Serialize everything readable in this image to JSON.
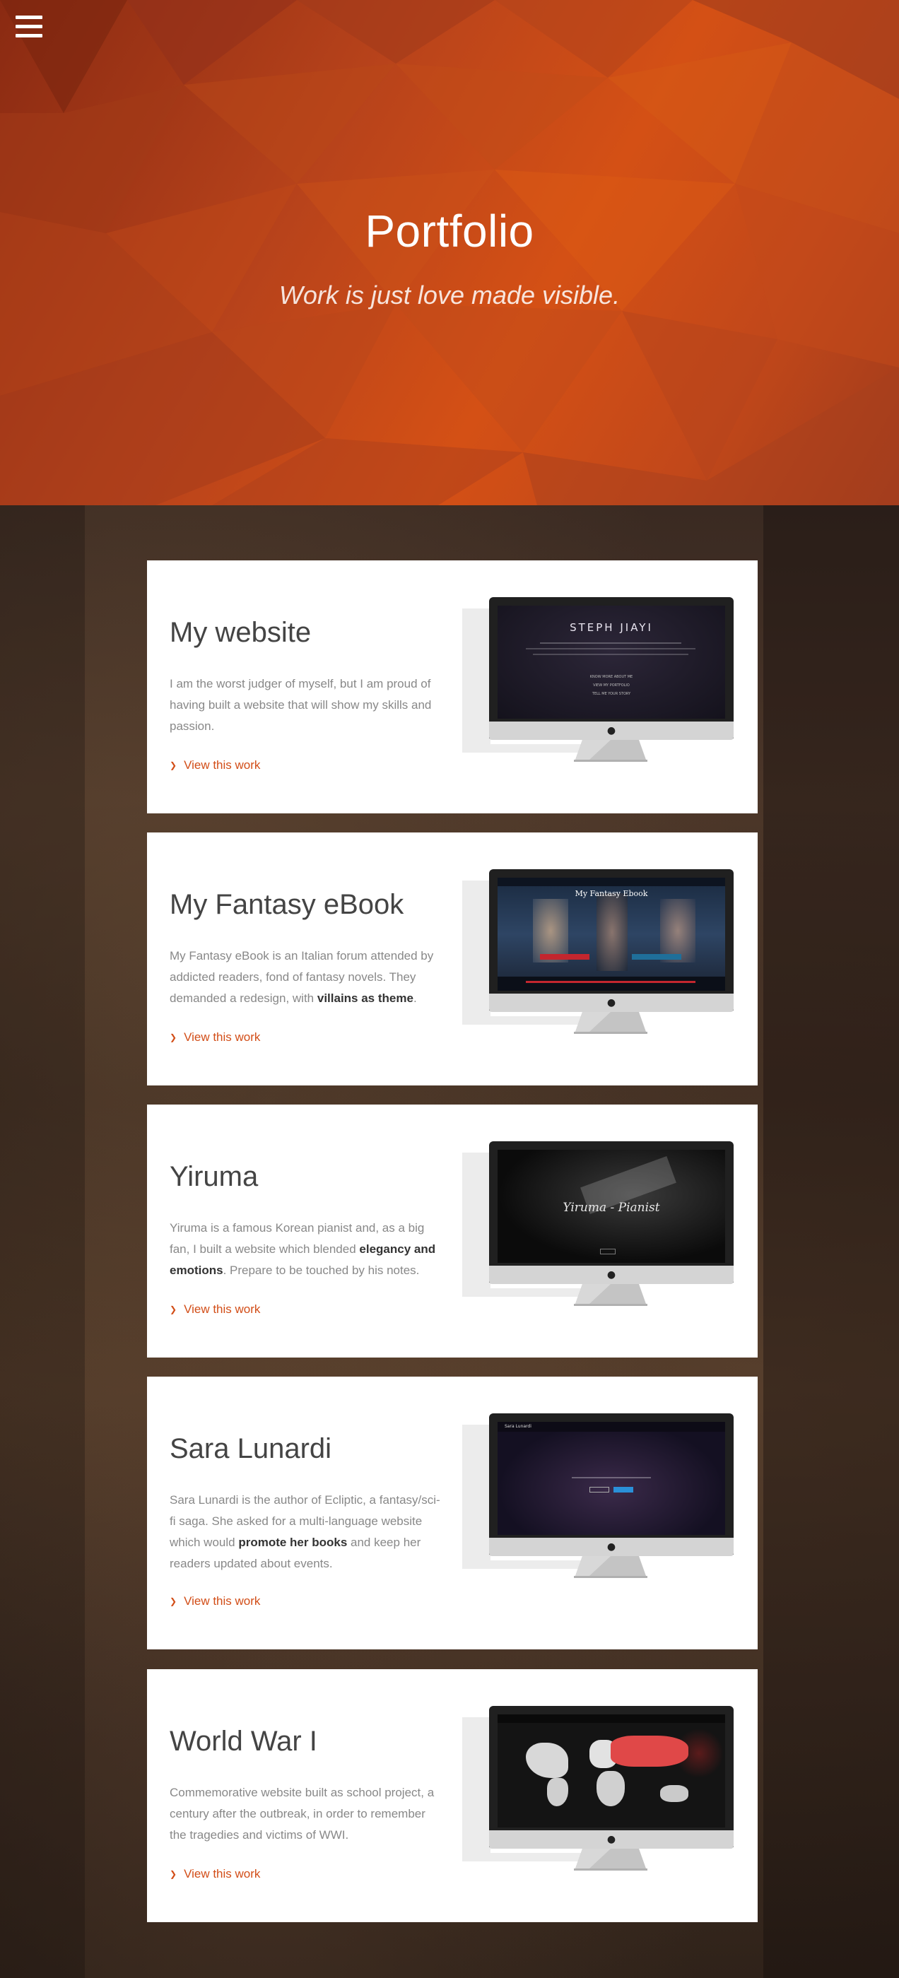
{
  "hero": {
    "title": "Portfolio",
    "subtitle": "Work is just love made visible.",
    "menu_icon": "hamburger-icon"
  },
  "colors": {
    "accent": "#d24d17",
    "hero_orange": "#c2481a",
    "title_text": "#444444",
    "body_text": "#888888"
  },
  "works": [
    {
      "title": "My website",
      "desc_html": "I am the worst judger of myself, but I am proud of having built a website that will show my skills and passion.",
      "link": "View this work",
      "screen": {
        "heading": "STEPH JIAYI",
        "items": [
          "KNOW MORE ABOUT ME",
          "VIEW MY PORTFOLIO",
          "TELL ME YOUR STORY"
        ]
      }
    },
    {
      "title": "My Fantasy eBook",
      "desc_before": "My Fantasy eBook is an Italian forum attended by addicted readers, fond of fantasy novels. They demanded a redesign, with ",
      "desc_bold": "villains as theme",
      "desc_after": ".",
      "link": "View this work",
      "screen": {
        "heading": "My Fantasy Ebook"
      }
    },
    {
      "title": "Yiruma",
      "desc_before": "Yiruma is a famous Korean pianist and, as a big fan, I built a website which blended ",
      "desc_bold": "elegancy and emotions",
      "desc_after": ". Prepare to be touched by his notes.",
      "link": "View this work",
      "screen": {
        "heading": "Yiruma - Pianist"
      }
    },
    {
      "title": "Sara Lunardi",
      "desc_before": "Sara Lunardi is the author of Ecliptic, a fantasy/sci-fi saga. She asked for a multi-language website which would ",
      "desc_bold": "promote her books",
      "desc_after": " and keep her readers updated about events.",
      "link": "View this work",
      "screen": {
        "heading": "Sara Lunardi"
      }
    },
    {
      "title": "World War I",
      "desc_before": "Commemorative website built as school project, a century after the outbreak, in order to remember the tragedies and victims of WWI.",
      "desc_bold": "",
      "desc_after": "",
      "link": "View this work",
      "screen": {
        "heading": ""
      }
    }
  ]
}
